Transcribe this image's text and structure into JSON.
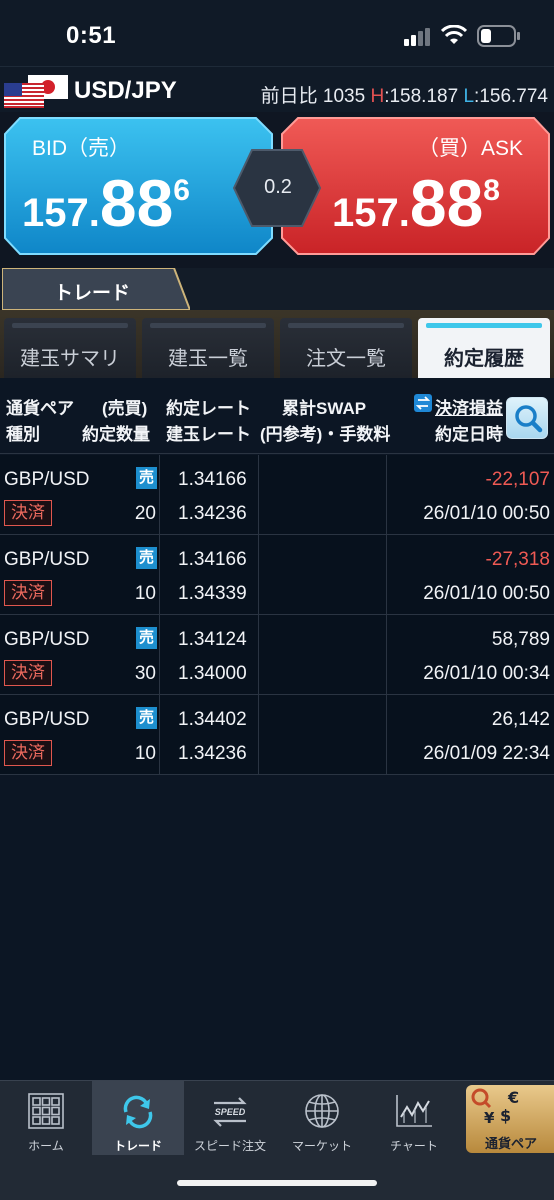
{
  "status_bar": {
    "time": "0:51"
  },
  "pair_bar": {
    "pair": "USD/JPY",
    "change_label": "前日比",
    "change_value": "1035",
    "high_label": "H",
    "high_value": "158.187",
    "low_label": "L",
    "low_value": "156.774"
  },
  "quote": {
    "bid_label": "BID（売）",
    "bid_main": "157.",
    "bid_big": "88",
    "bid_small": "6",
    "spread": "0.2",
    "ask_label": "（買）ASK",
    "ask_main": "157.",
    "ask_big": "88",
    "ask_small": "8"
  },
  "section_tab": "トレード",
  "sub_tabs": [
    {
      "label": "建玉サマリ"
    },
    {
      "label": "建玉一覧"
    },
    {
      "label": "注文一覧"
    },
    {
      "label": "約定履歴"
    }
  ],
  "columns": {
    "pair": "通貨ペア",
    "side": "(売買)",
    "rate": "約定レート",
    "swap": "累計SWAP",
    "pl": "決済損益",
    "type": "種別",
    "qty": "約定数量",
    "open_rate": "建玉レート",
    "fee": "(円参考)・手数料",
    "date": "約定日時"
  },
  "rows": [
    {
      "pair": "GBP/USD",
      "side": "売",
      "kind": "決済",
      "qty": "20",
      "rate": "1.34166",
      "open_rate": "1.34236",
      "pl": "-22,107",
      "date": "26/01/10 00:50"
    },
    {
      "pair": "GBP/USD",
      "side": "売",
      "kind": "決済",
      "qty": "10",
      "rate": "1.34166",
      "open_rate": "1.34339",
      "pl": "-27,318",
      "date": "26/01/10 00:50"
    },
    {
      "pair": "GBP/USD",
      "side": "売",
      "kind": "決済",
      "qty": "30",
      "rate": "1.34124",
      "open_rate": "1.34000",
      "pl": "58,789",
      "date": "26/01/10 00:34"
    },
    {
      "pair": "GBP/USD",
      "side": "売",
      "kind": "決済",
      "qty": "10",
      "rate": "1.34402",
      "open_rate": "1.34236",
      "pl": "26,142",
      "date": "26/01/09 22:34"
    }
  ],
  "nav": [
    {
      "label": "ホーム",
      "icon": "grid-icon"
    },
    {
      "label": "トレード",
      "icon": "refresh-icon"
    },
    {
      "label": "スピード注文",
      "icon": "speed-icon"
    },
    {
      "label": "マーケット",
      "icon": "globe-icon"
    },
    {
      "label": "チャート",
      "icon": "chart-icon"
    },
    {
      "label": "通貨ペア",
      "icon": "currency-icon"
    }
  ],
  "nav_speed_text": "SPEED"
}
